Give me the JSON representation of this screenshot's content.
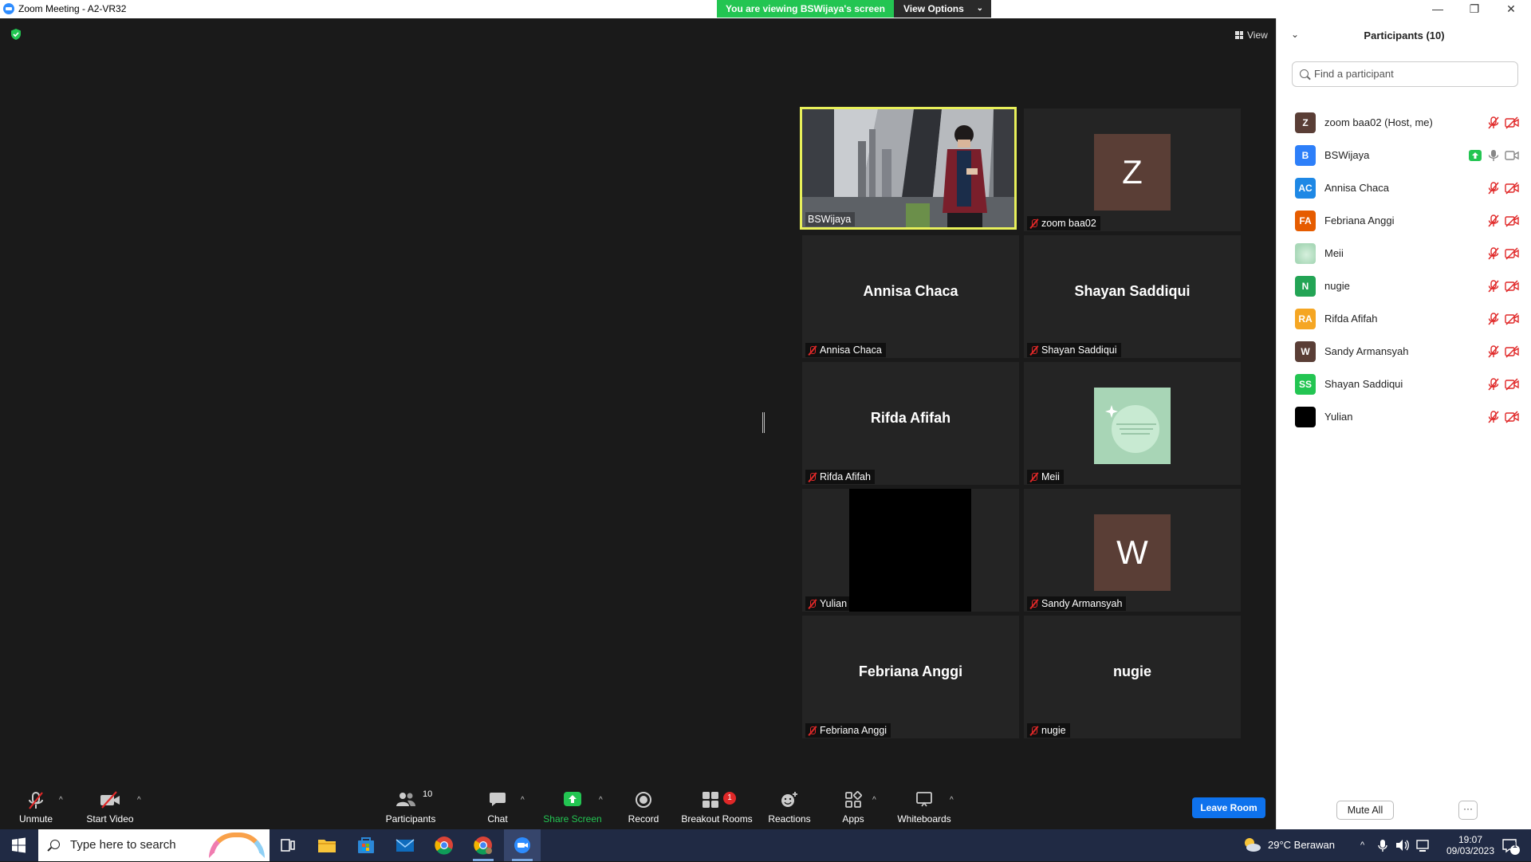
{
  "window": {
    "title": "Zoom Meeting - A2-VR32",
    "minimize": "—",
    "restore": "❐",
    "close": "✕"
  },
  "banner": {
    "message": "You are viewing BSWijaya's screen",
    "view_options": "View Options"
  },
  "meeting": {
    "view_label": "View"
  },
  "gallery": {
    "tiles": [
      {
        "name": "BSWijaya",
        "display": "video"
      },
      {
        "name": "zoom baa02",
        "display": "avatar",
        "initial": "Z"
      },
      {
        "name": "Annisa Chaca",
        "display": "name",
        "big_name": "Annisa Chaca"
      },
      {
        "name": "Shayan Saddiqui",
        "display": "name",
        "big_name": "Shayan Saddiqui"
      },
      {
        "name": "Rifda Afifah",
        "display": "name",
        "big_name": "Rifda Afifah"
      },
      {
        "name": "Meii",
        "display": "image"
      },
      {
        "name": "Yulian",
        "display": "black"
      },
      {
        "name": "Sandy Armansyah",
        "display": "avatar",
        "initial": "W"
      },
      {
        "name": "Febriana Anggi",
        "display": "name",
        "big_name": "Febriana Anggi"
      },
      {
        "name": "nugie",
        "display": "name",
        "big_name": "nugie"
      }
    ]
  },
  "toolbar": {
    "unmute": "Unmute",
    "start_video": "Start Video",
    "participants": "Participants",
    "participants_count": "10",
    "chat": "Chat",
    "share_screen": "Share Screen",
    "record": "Record",
    "breakout_rooms": "Breakout Rooms",
    "breakout_badge": "1",
    "reactions": "Reactions",
    "apps": "Apps",
    "whiteboards": "Whiteboards",
    "leave_room": "Leave Room"
  },
  "panel": {
    "title": "Participants (10)",
    "search_placeholder": "Find a participant",
    "participants": [
      {
        "initials": "Z",
        "name": "zoom baa02 (Host, me)",
        "color": "#5a3e36"
      },
      {
        "initials": "B",
        "name": "BSWijaya",
        "color": "#2d7ff9"
      },
      {
        "initials": "AC",
        "name": "Annisa Chaca",
        "color": "#1e88e5"
      },
      {
        "initials": "FA",
        "name": "Febriana Anggi",
        "color": "#e65c00"
      },
      {
        "initials": "",
        "name": "Meii",
        "color": "#a9d8b8"
      },
      {
        "initials": "N",
        "name": "nugie",
        "color": "#23a455"
      },
      {
        "initials": "RA",
        "name": "Rifda Afifah",
        "color": "#f5a623"
      },
      {
        "initials": "W",
        "name": "Sandy Armansyah",
        "color": "#5a3e36"
      },
      {
        "initials": "SS",
        "name": "Shayan Saddiqui",
        "color": "#23c552"
      },
      {
        "initials": "",
        "name": "Yulian",
        "color": "#000000"
      }
    ],
    "mute_all": "Mute All",
    "more": "···"
  },
  "taskbar": {
    "search_placeholder": "Type here to search",
    "weather": "29°C  Berawan",
    "time": "19:07",
    "date": "09/03/2023",
    "notifications": "1"
  }
}
